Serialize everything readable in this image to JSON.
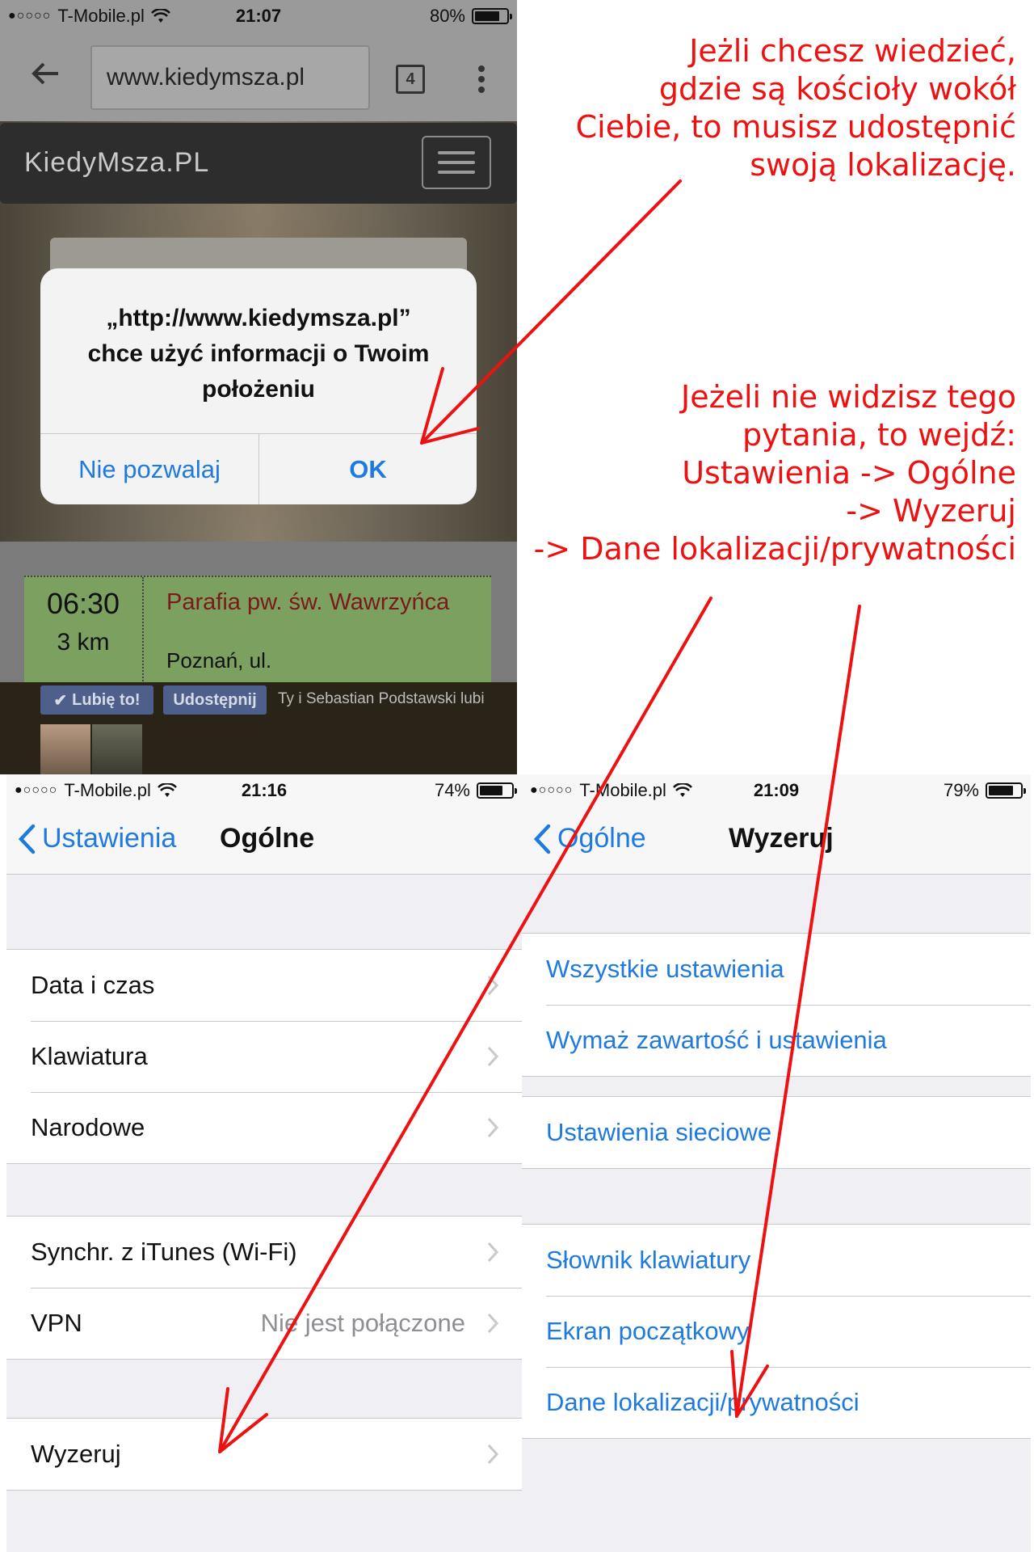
{
  "browser": {
    "status": {
      "carrier": "T-Mobile.pl",
      "time": "21:07",
      "battery": "80%",
      "battery_level": 0.8
    },
    "url": "www.kiedymsza.pl",
    "tab_count": "4",
    "site_brand": "KiedyMsza.PL",
    "alert": {
      "line1": "„http://www.kiedymsza.pl”",
      "line2": "chce użyć informacji o Twoim",
      "line3": "położeniu",
      "deny_label": "Nie pozwalaj",
      "ok_label": "OK"
    },
    "mass": {
      "time": "06:30",
      "distance": "3 km",
      "name": "Parafia pw. św. Wawrzyńca",
      "address": "Poznań, ul."
    },
    "facebook": {
      "like_label": "Lubię to!",
      "share_label": "Udostępnij",
      "text": "Ty i Sebastian Podstawski lubi"
    }
  },
  "annotations": {
    "note1": [
      "Jeżli chcesz wiedzieć,",
      "gdzie są kościoły wokół",
      "Ciebie, to musisz udostępnić",
      "swoją lokalizację."
    ],
    "note2": [
      "Jeżeli nie widzisz tego",
      "pytania, to wejdź:",
      "Ustawienia -> Ogólne",
      "-> Wyzeruj",
      "-> Dane lokalizacji/prywatności"
    ]
  },
  "general": {
    "status": {
      "carrier": "T-Mobile.pl",
      "time": "21:16",
      "battery": "74%",
      "battery_level": 0.74
    },
    "back_label": "Ustawienia",
    "title": "Ogólne",
    "groups": [
      [
        {
          "label": "Data i czas"
        },
        {
          "label": "Klawiatura"
        },
        {
          "label": "Narodowe"
        }
      ],
      [
        {
          "label": "Synchr. z iTunes (Wi-Fi)"
        },
        {
          "label": "VPN",
          "value": "Nie jest połączone"
        }
      ],
      [
        {
          "label": "Wyzeruj"
        }
      ]
    ]
  },
  "reset": {
    "status": {
      "carrier": "T-Mobile.pl",
      "time": "21:09",
      "battery": "79%",
      "battery_level": 0.79
    },
    "back_label": "Ogólne",
    "title": "Wyzeruj",
    "groups": [
      [
        {
          "label": "Wszystkie ustawienia"
        },
        {
          "label": "Wymaż zawartość i ustawienia"
        }
      ],
      [
        {
          "label": "Ustawienia sieciowe"
        }
      ],
      [
        {
          "label": "Słownik klawiatury"
        },
        {
          "label": "Ekran początkowy"
        },
        {
          "label": "Dane lokalizacji/prywatności"
        }
      ]
    ]
  },
  "colors": {
    "annotation": "#ee1111",
    "ios_blue": "#1f7ae0",
    "card_green": "#7ba060"
  }
}
